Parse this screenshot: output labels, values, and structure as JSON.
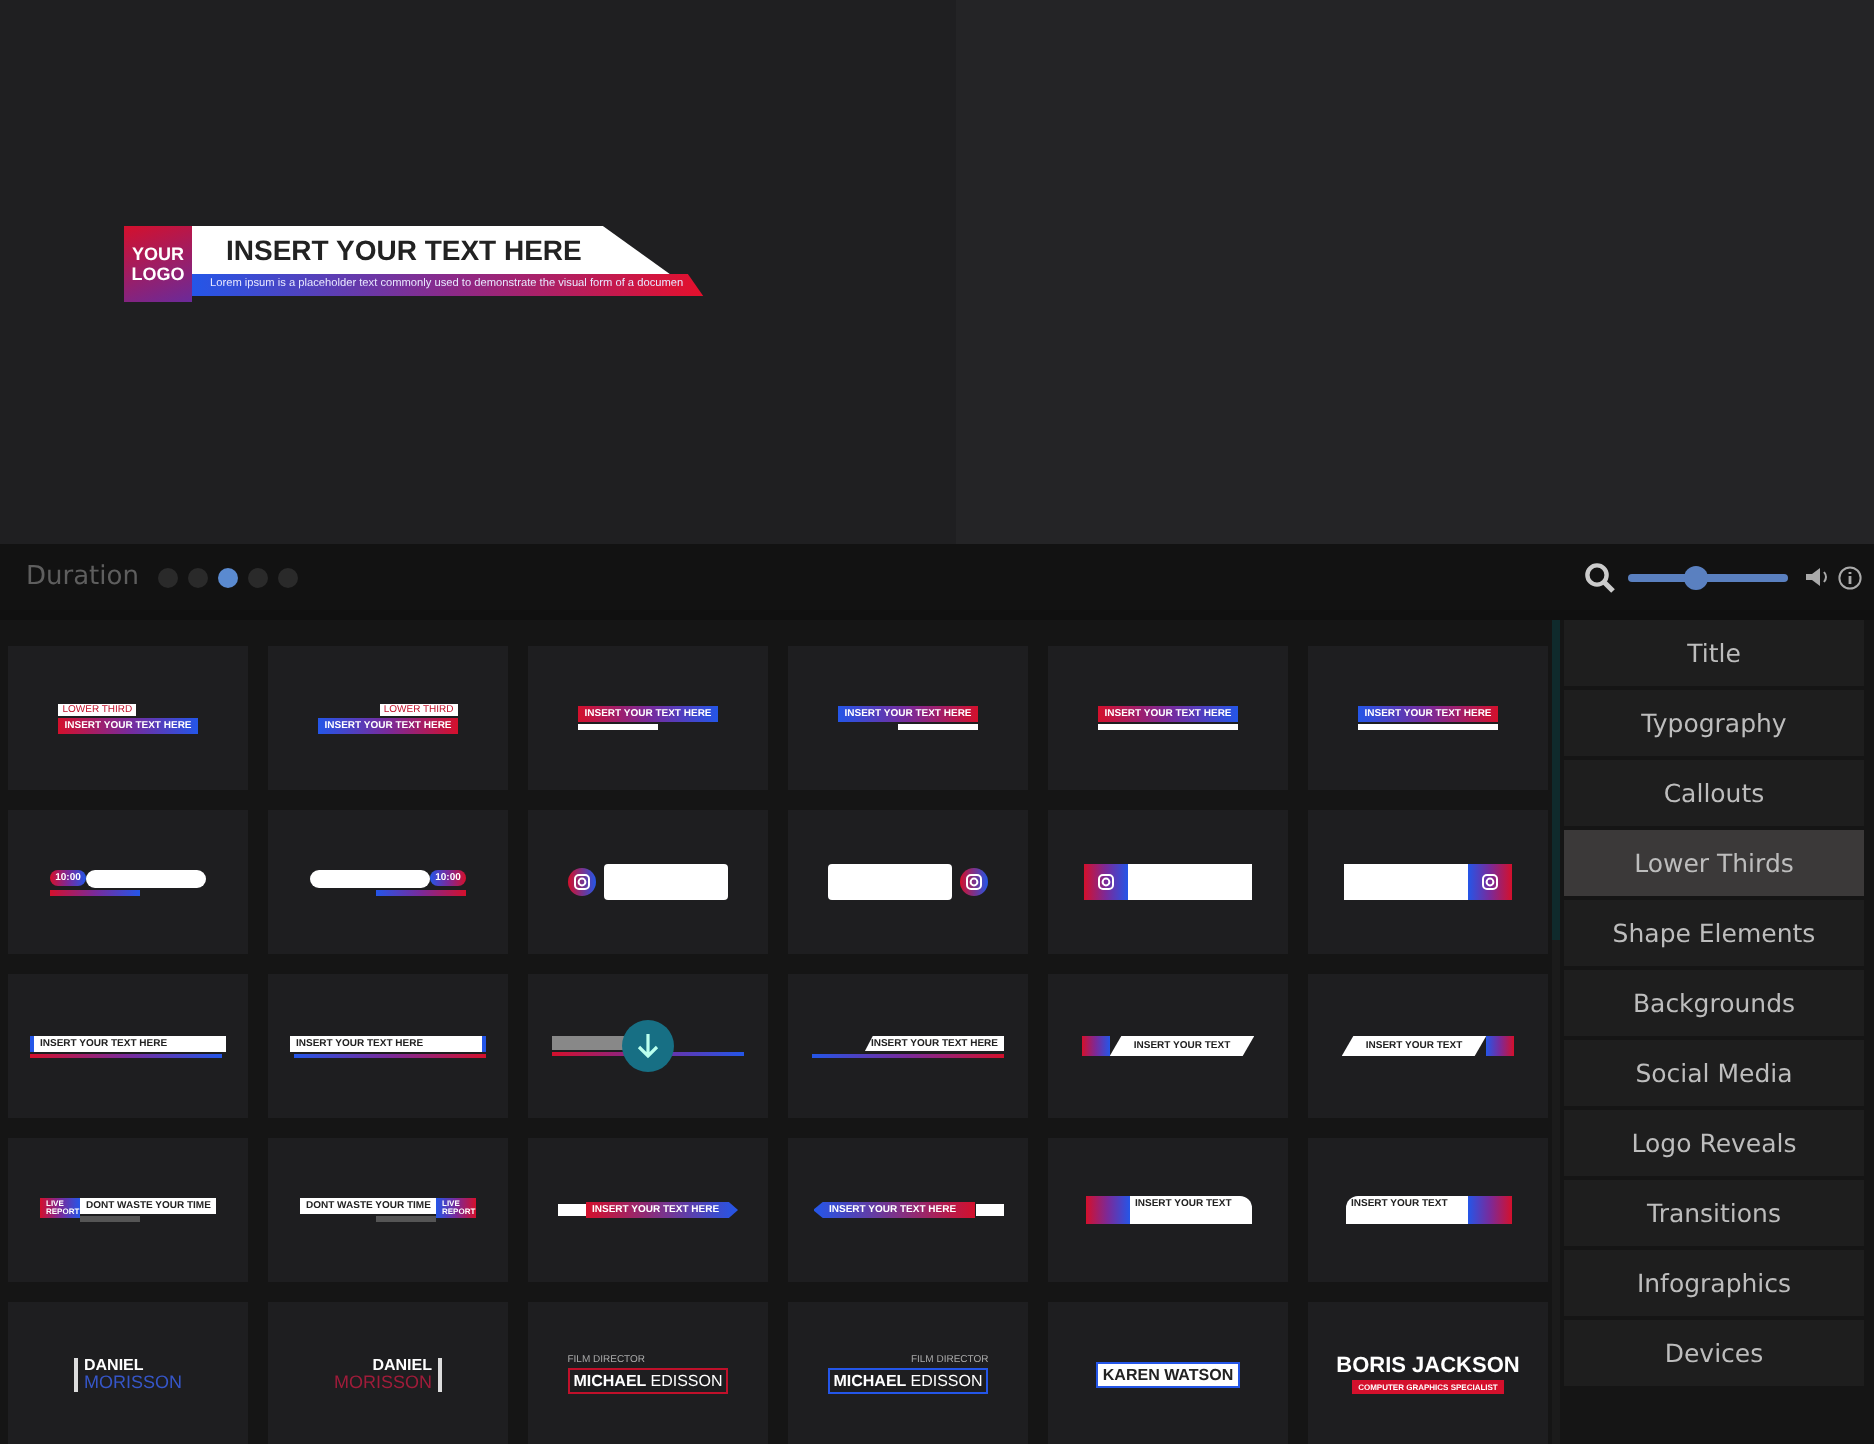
{
  "preview": {
    "lower_third": {
      "logo": "YOUR LOGO",
      "title": "INSERT YOUR TEXT HERE",
      "subtitle": "Lorem ipsum is a placeholder text commonly used to demonstrate the visual form of a documen"
    }
  },
  "toolbar": {
    "label": "Duration",
    "dots": [
      {
        "selected": false
      },
      {
        "selected": false
      },
      {
        "selected": true
      },
      {
        "selected": false
      },
      {
        "selected": false
      }
    ],
    "zoom": {
      "level": 0.42
    }
  },
  "template_grid": {
    "thumbnails": [
      {
        "kind": "tag",
        "mirrored": false,
        "label": "LOWER THIRD",
        "title": "INSERT YOUR TEXT HERE",
        "hovered": false
      },
      {
        "kind": "tag",
        "mirrored": true,
        "label": "LOWER THIRD",
        "title": "INSERT YOUR TEXT HERE",
        "hovered": false
      },
      {
        "kind": "bar",
        "mirrored": false,
        "title": "INSERT YOUR TEXT HERE",
        "hovered": false
      },
      {
        "kind": "bar",
        "mirrored": true,
        "title": "INSERT YOUR TEXT HERE",
        "hovered": false
      },
      {
        "kind": "band",
        "mirrored": false,
        "title": "INSERT YOUR TEXT HERE",
        "hovered": false
      },
      {
        "kind": "band",
        "mirrored": true,
        "title": "INSERT YOUR TEXT HERE",
        "hovered": false
      },
      {
        "kind": "pill",
        "mirrored": false,
        "label": "10:00",
        "hovered": false
      },
      {
        "kind": "pill",
        "mirrored": true,
        "label": "10:00",
        "hovered": false
      },
      {
        "kind": "social",
        "mirrored": false,
        "hovered": false
      },
      {
        "kind": "social",
        "mirrored": true,
        "hovered": false
      },
      {
        "kind": "social-card",
        "mirrored": false,
        "hovered": false
      },
      {
        "kind": "social-card",
        "mirrored": true,
        "hovered": false
      },
      {
        "kind": "strip",
        "mirrored": false,
        "title": "INSERT YOUR TEXT HERE",
        "hovered": false
      },
      {
        "kind": "strip",
        "mirrored": true,
        "title": "INSERT YOUR TEXT HERE",
        "hovered": false
      },
      {
        "kind": "ribbon",
        "mirrored": false,
        "hovered": true
      },
      {
        "kind": "ribbon",
        "mirrored": true,
        "title": "INSERT YOUR TEXT HERE",
        "hovered": false
      },
      {
        "kind": "slant",
        "mirrored": false,
        "title": "INSERT YOUR TEXT",
        "hovered": false
      },
      {
        "kind": "slant",
        "mirrored": true,
        "title": "INSERT YOUR TEXT",
        "hovered": false
      },
      {
        "kind": "report",
        "mirrored": false,
        "label": "LIVE REPORT",
        "title": "DONT WASTE YOUR TIME",
        "hovered": false
      },
      {
        "kind": "report",
        "mirrored": true,
        "label": "LIVE REPORT",
        "title": "DONT WASTE YOUR TIME",
        "hovered": false
      },
      {
        "kind": "arrow",
        "mirrored": false,
        "title": "INSERT YOUR TEXT HERE",
        "hovered": false
      },
      {
        "kind": "arrow",
        "mirrored": true,
        "title": "INSERT YOUR TEXT HERE",
        "hovered": false
      },
      {
        "kind": "tab",
        "mirrored": false,
        "title": "INSERT YOUR TEXT",
        "hovered": false
      },
      {
        "kind": "tab",
        "mirrored": true,
        "title": "INSERT YOUR TEXT",
        "hovered": false
      },
      {
        "kind": "name",
        "mirrored": false,
        "title": "DANIEL",
        "subtitle": "MORISSON",
        "hovered": false
      },
      {
        "kind": "name",
        "mirrored": true,
        "title": "DANIEL",
        "subtitle": "MORISSON",
        "hovered": false
      },
      {
        "kind": "name-box",
        "mirrored": false,
        "label": "FILM DIRECTOR",
        "title": "MICHAEL",
        "subtitle": "EDISSON",
        "hovered": false
      },
      {
        "kind": "name-box",
        "mirrored": true,
        "label": "FILM DIRECTOR",
        "title": "MICHAEL",
        "subtitle": "EDISSON",
        "hovered": false
      },
      {
        "kind": "boxed",
        "title": "KAREN WATSON",
        "hovered": false
      },
      {
        "kind": "banner",
        "title": "BORIS JACKSON",
        "label": "COMPUTER GRAPHICS SPECIALIST",
        "hovered": false
      }
    ]
  },
  "categories": [
    {
      "label": "Title",
      "selected": false
    },
    {
      "label": "Typography",
      "selected": false
    },
    {
      "label": "Callouts",
      "selected": false
    },
    {
      "label": "Lower Thirds",
      "selected": true
    },
    {
      "label": "Shape Elements",
      "selected": false
    },
    {
      "label": "Backgrounds",
      "selected": false
    },
    {
      "label": "Social Media",
      "selected": false
    },
    {
      "label": "Logo Reveals",
      "selected": false
    },
    {
      "label": "Transitions",
      "selected": false
    },
    {
      "label": "Infographics",
      "selected": false
    },
    {
      "label": "Devices",
      "selected": false
    }
  ]
}
